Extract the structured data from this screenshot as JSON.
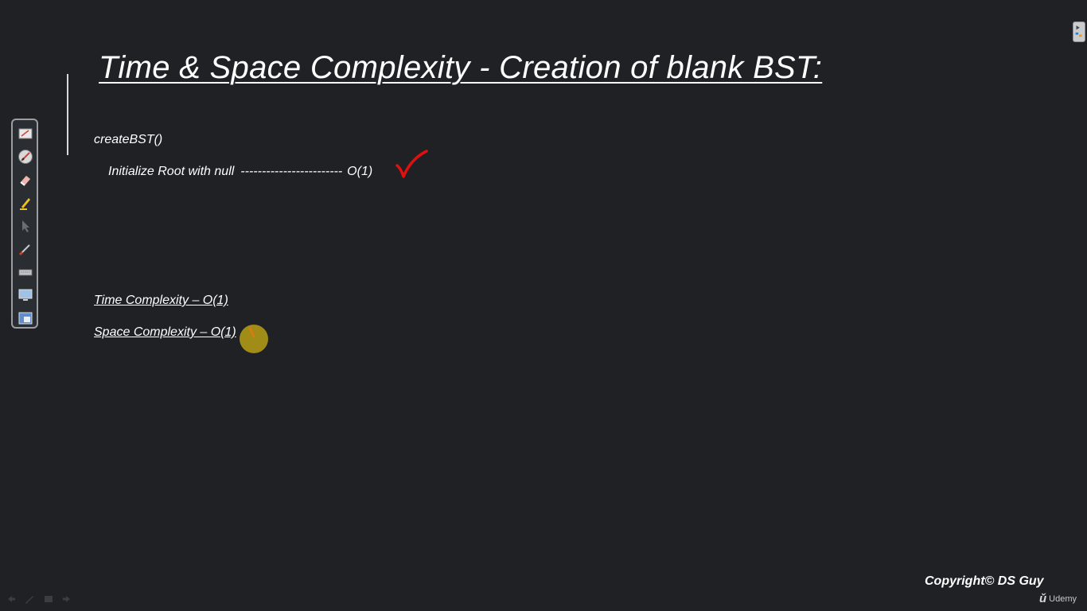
{
  "slide": {
    "title": "Time & Space Complexity - Creation of blank BST:",
    "function_name": "createBST()",
    "init_statement": "Initialize Root with null",
    "init_dashes": "------------------------",
    "init_cost": "O(1)",
    "time_complexity": "Time Complexity – O(1)",
    "space_complexity": "Space Complexity – O(1)"
  },
  "toolbar": {
    "tools": [
      {
        "icon": "whiteboard-icon"
      },
      {
        "icon": "pen-disabled-icon"
      },
      {
        "icon": "eraser-icon"
      },
      {
        "icon": "highlighter-icon"
      },
      {
        "icon": "pointer-icon"
      },
      {
        "icon": "brush-icon"
      },
      {
        "icon": "keyboard-icon"
      },
      {
        "icon": "screen-icon"
      },
      {
        "icon": "screen-switch-icon"
      }
    ]
  },
  "footer": {
    "copyright": "Copyright© DS Guy",
    "brand_logo": "ǔ",
    "brand_name": "Udemy"
  },
  "colors": {
    "background": "#1f2124",
    "text": "#ffffff",
    "checkmark": "#e01010",
    "cursor_highlight": "#c8aa14"
  }
}
